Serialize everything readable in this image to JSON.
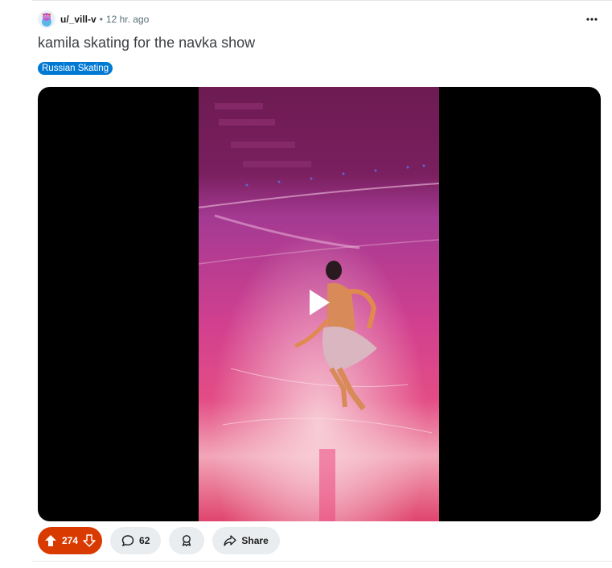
{
  "post": {
    "author": "u/_vill-v",
    "separator": "•",
    "time": "12 hr. ago",
    "title": "kamila skating for the navka show",
    "flair": "Russian Skating"
  },
  "media": {
    "type": "video",
    "play_icon": "play-icon"
  },
  "actions": {
    "upvote_icon": "upvote-arrow-icon",
    "downvote_icon": "downvote-arrow-icon",
    "score": "274",
    "comments_count": "62",
    "award_icon": "award-icon",
    "share_label": "Share"
  },
  "colors": {
    "vote_active": "#d93a00",
    "flair_bg": "#0079d3",
    "button_bg": "#eaedef"
  }
}
